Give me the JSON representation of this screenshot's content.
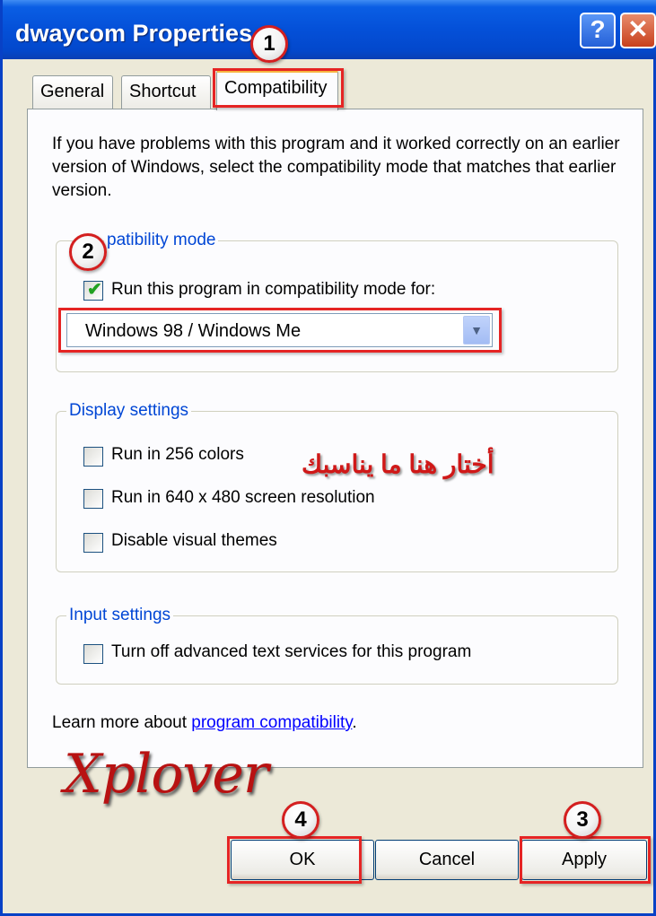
{
  "window": {
    "title": "dwaycom Properties",
    "help_glyph": "?",
    "close_glyph": "✕"
  },
  "tabs": [
    {
      "label": "General"
    },
    {
      "label": "Shortcut"
    },
    {
      "label": "Compatibility"
    }
  ],
  "intro_text": "If you have problems with this program and it worked correctly on an earlier version of Windows, select the compatibility mode that matches that earlier version.",
  "compat_group": {
    "title": "patibility mode",
    "checkbox_label": "Run this program in compatibility mode for:",
    "checked": true,
    "select_value": "Windows 98 / Windows Me"
  },
  "display_group": {
    "title": "Display settings",
    "options": [
      {
        "label": "Run in 256 colors",
        "checked": false
      },
      {
        "label": "Run in 640 x 480 screen resolution",
        "checked": false
      },
      {
        "label": "Disable visual themes",
        "checked": false
      }
    ]
  },
  "input_group": {
    "title": "Input settings",
    "option": {
      "label": "Turn off advanced text services for this program",
      "checked": false
    }
  },
  "learn_more": {
    "prefix": "Learn more about ",
    "link": "program compatibility",
    "suffix": "."
  },
  "annotation_text": "أختار هنا ما يناسبك",
  "brand_text": "Xplover",
  "markers": [
    "1",
    "2",
    "3",
    "4"
  ],
  "buttons": {
    "ok": "OK",
    "cancel": "Cancel",
    "apply": "Apply"
  },
  "colors": {
    "titlebar": "#0450d8",
    "group_title": "#0046d5",
    "annotation_red": "#e52424",
    "link": "#0000ff"
  }
}
